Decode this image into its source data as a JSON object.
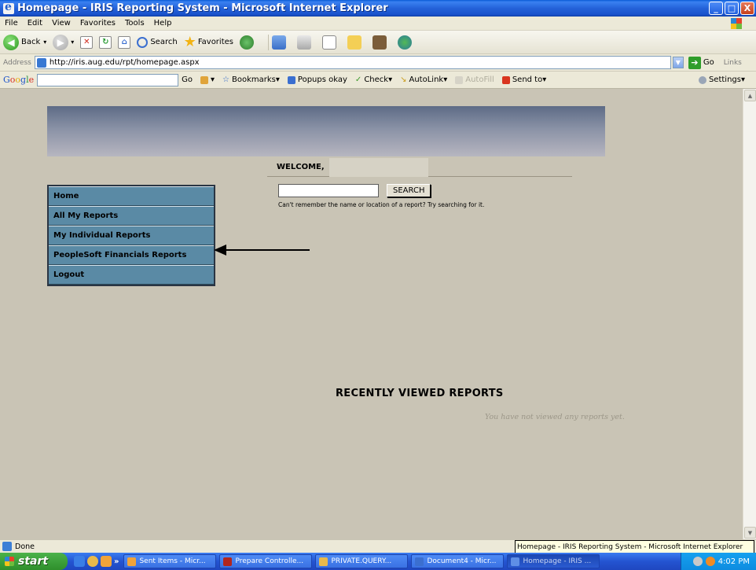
{
  "window": {
    "title": "Homepage - IRIS Reporting System - Microsoft Internet Explorer",
    "min_label": "_",
    "max_label": "□",
    "close_label": "X"
  },
  "menubar": [
    "File",
    "Edit",
    "View",
    "Favorites",
    "Tools",
    "Help"
  ],
  "toolbar": {
    "back": "Back",
    "search": "Search",
    "favorites": "Favorites"
  },
  "address": {
    "label": "Address",
    "url": "http://iris.aug.edu/rpt/homepage.aspx",
    "go": "Go",
    "links": "Links"
  },
  "googlebar": {
    "go": "Go",
    "bookmarks": "Bookmarks",
    "popups": "Popups okay",
    "check": "Check",
    "autolink": "AutoLink",
    "autofill": "AutoFill",
    "sendto": "Send to",
    "settings": "Settings"
  },
  "page": {
    "welcome": "WELCOME,",
    "search_button": "SEARCH",
    "search_value": "",
    "search_hint": "Can't remember the name or location of a report? Try searching for it.",
    "nav": [
      {
        "label": "Home"
      },
      {
        "label": "All My Reports"
      },
      {
        "label": "My Individual Reports"
      },
      {
        "label": "PeopleSoft Financials Reports"
      },
      {
        "label": "Logout"
      }
    ],
    "recent_title": "RECENTLY VIEWED REPORTS",
    "recent_empty": "You have not viewed any reports yet."
  },
  "status": {
    "text": "Done",
    "tooltip": "Homepage - IRIS Reporting System - Microsoft Internet Explorer"
  },
  "taskbar": {
    "start": "start",
    "more": "»",
    "tasks": [
      {
        "label": "Sent Items - Micr...",
        "color": "#f0a33a"
      },
      {
        "label": "Prepare Controlle...",
        "color": "#b2261e"
      },
      {
        "label": "PRIVATE.QUERY...",
        "color": "#e9b94a"
      },
      {
        "label": "Document4 - Micr...",
        "color": "#3b6fd0"
      },
      {
        "label": "Homepage - IRIS ...",
        "color": "#3b6fd0"
      }
    ],
    "clock": "4:02 PM"
  },
  "colors": {
    "nav_bg": "#5a8aa5",
    "header_top": "#5d6b86",
    "page_bg": "#c9c4b5"
  }
}
